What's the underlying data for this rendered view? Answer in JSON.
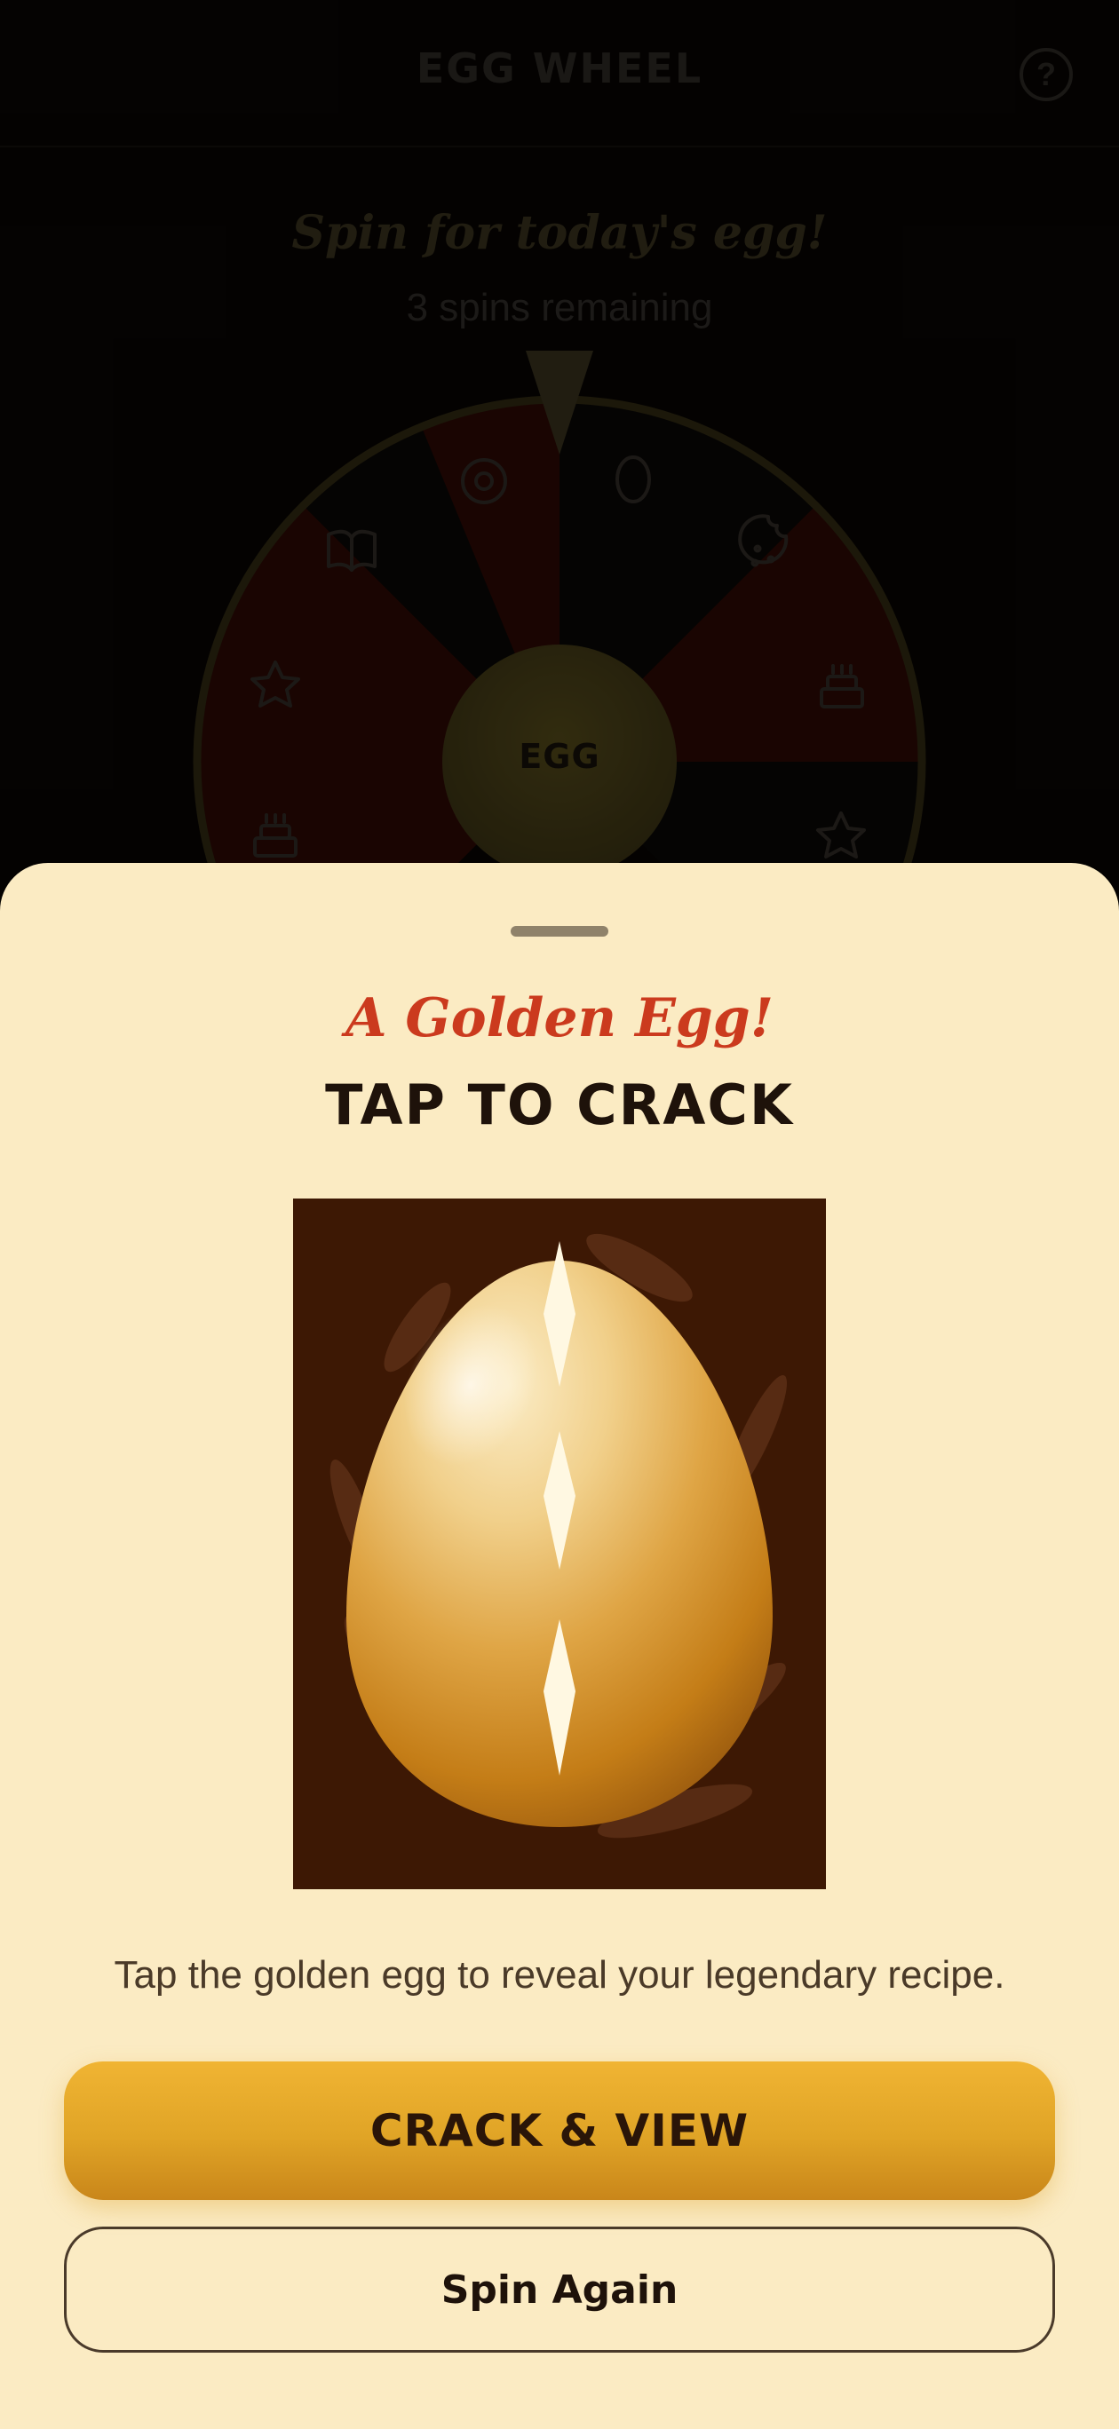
{
  "header": {
    "title": "EGG WHEEL",
    "help_label": "?"
  },
  "wheel": {
    "subtitle": "Spin for today's egg!",
    "spins_remaining": "3 spins remaining",
    "center_label": "EGG",
    "segment_icons": [
      "egg-icon",
      "cookie-icon",
      "cake-icon",
      "star-icon",
      "cake-icon",
      "star-icon",
      "book-icon",
      "donut-icon"
    ]
  },
  "sheet": {
    "kicker": "A Golden Egg!",
    "title": "TAP TO CRACK",
    "hint": "Tap the golden egg to reveal your legendary recipe.",
    "primary_button": "CRACK & VIEW",
    "secondary_button": "Spin Again"
  },
  "colors": {
    "sheet_bg": "#fbebc3",
    "accent_red": "#cb3a1e",
    "gold": "#e8ac2e",
    "egg_card_bg": "#3d1804",
    "wheel_red": "#3a0c06",
    "wheel_dark": "#0d0a08"
  }
}
